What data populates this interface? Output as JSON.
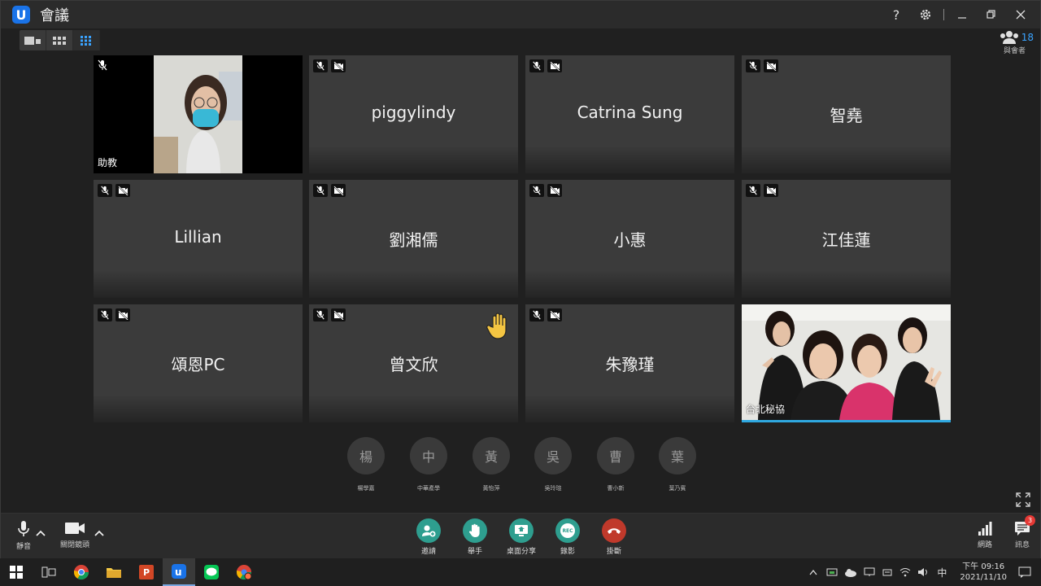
{
  "window": {
    "title": "會議",
    "app_logo": "U",
    "help": "?"
  },
  "participants": {
    "count": "18",
    "label": "與會者"
  },
  "tiles": [
    {
      "name": "",
      "corner_label": "助教",
      "video": true
    },
    {
      "name": "piggylindy",
      "corner_label": ""
    },
    {
      "name": "Catrina Sung",
      "corner_label": ""
    },
    {
      "name": "智堯",
      "corner_label": ""
    },
    {
      "name": "Lillian",
      "corner_label": ""
    },
    {
      "name": "劉湘儒",
      "corner_label": ""
    },
    {
      "name": "小惠",
      "corner_label": ""
    },
    {
      "name": "江佳蓮",
      "corner_label": ""
    },
    {
      "name": "頌恩PC",
      "corner_label": ""
    },
    {
      "name": "曾文欣",
      "corner_label": ""
    },
    {
      "name": "朱豫瑾",
      "corner_label": ""
    },
    {
      "name": "",
      "corner_label": "台北秘協",
      "video": true
    }
  ],
  "waiting": [
    {
      "initial": "楊",
      "name": "楊學嘉"
    },
    {
      "initial": "中",
      "name": "中華產學"
    },
    {
      "initial": "黃",
      "name": "黃怡萍"
    },
    {
      "initial": "吳",
      "name": "吳玲瑄"
    },
    {
      "initial": "曹",
      "name": "曹小新"
    },
    {
      "initial": "葉",
      "name": "葉乃賓"
    }
  ],
  "toolbar": {
    "mute_label": "靜音",
    "camera_label": "關閉鏡頭",
    "invite_label": "邀請",
    "raise_hand_label": "舉手",
    "share_label": "桌面分享",
    "record_label": "錄影",
    "record_text": "REC",
    "hangup_label": "掛斷",
    "network_label": "網路",
    "messages_label": "訊息",
    "messages_badge": "3"
  },
  "taskbar": {
    "ime": "中",
    "time": "下午 09:16",
    "date": "2021/11/10"
  },
  "colors": {
    "accent": "#2fa8e0",
    "invite": "#2e9e8f",
    "hangup": "#c0392b",
    "logo": "#1a73e8"
  }
}
